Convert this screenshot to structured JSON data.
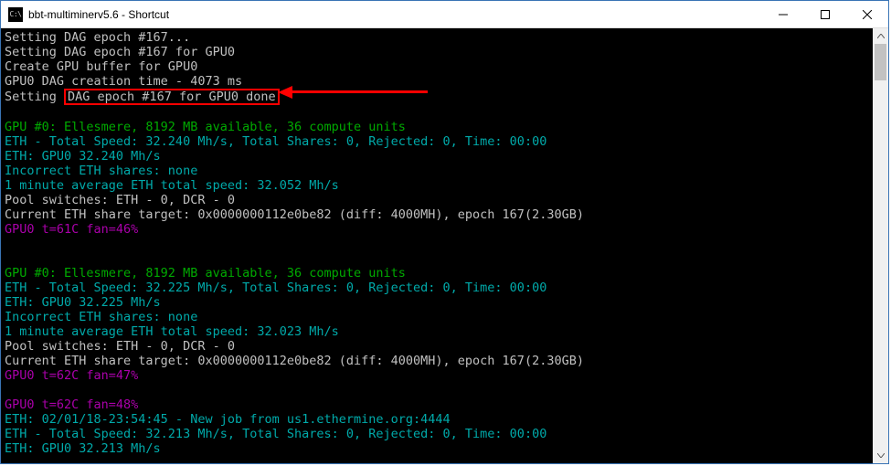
{
  "window": {
    "icon_glyph": "C:\\",
    "title": "bbt-multiminerv5.6 - Shortcut"
  },
  "lines": {
    "l1": "Setting DAG epoch #167...",
    "l2": "Setting DAG epoch #167 for GPU0",
    "l3": "Create GPU buffer for GPU0",
    "l4": "GPU0 DAG creation time - 4073 ms",
    "l5a": "Setting ",
    "l5b": "DAG epoch #167 for GPU0 done",
    "blank": " ",
    "g1": "GPU #0: Ellesmere, 8192 MB available, 36 compute units",
    "c1": "ETH - Total Speed: 32.240 Mh/s, Total Shares: 0, Rejected: 0, Time: 00:00",
    "c2": "ETH: GPU0 32.240 Mh/s",
    "c3": "Incorrect ETH shares: none",
    "c4": "1 minute average ETH total speed: 32.052 Mh/s",
    "w1": "Pool switches: ETH - 0, DCR - 0",
    "w2": "Current ETH share target: 0x0000000112e0be82 (diff: 4000MH), epoch 167(2.30GB)",
    "m1": "GPU0 t=61C fan=46%",
    "g2": "GPU #0: Ellesmere, 8192 MB available, 36 compute units",
    "c5": "ETH - Total Speed: 32.225 Mh/s, Total Shares: 0, Rejected: 0, Time: 00:00",
    "c6": "ETH: GPU0 32.225 Mh/s",
    "c7": "Incorrect ETH shares: none",
    "c8": "1 minute average ETH total speed: 32.023 Mh/s",
    "w3": "Pool switches: ETH - 0, DCR - 0",
    "w4": "Current ETH share target: 0x0000000112e0be82 (diff: 4000MH), epoch 167(2.30GB)",
    "m2": "GPU0 t=62C fan=47%",
    "m3": "GPU0 t=62C fan=48%",
    "c9": "ETH: 02/01/18-23:54:45 - New job from us1.ethermine.org:4444",
    "c10": "ETH - Total Speed: 32.213 Mh/s, Total Shares: 0, Rejected: 0, Time: 00:00",
    "c11": "ETH: GPU0 32.213 Mh/s"
  }
}
